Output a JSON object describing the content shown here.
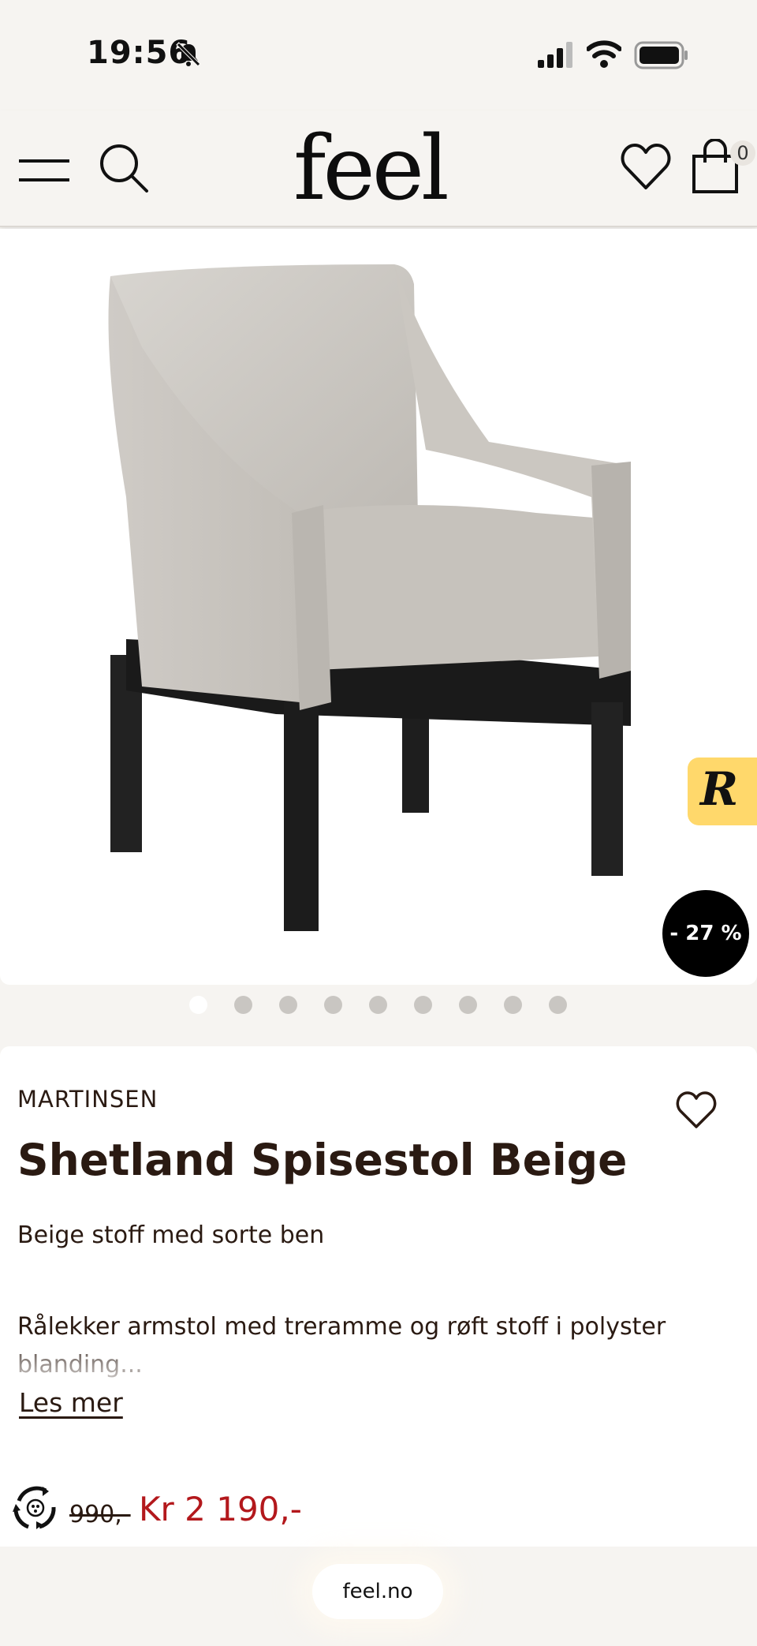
{
  "status_bar": {
    "time": "19:56"
  },
  "header": {
    "logo": "feel",
    "cart_count": "0"
  },
  "product": {
    "image_alt": "Shetland Spisestol Beige",
    "discount": "- 27 %",
    "gallery_count": 9,
    "gallery_active_index": 0,
    "brand": "MARTINSEN",
    "title": "Shetland Spisestol Beige",
    "subtitle": "Beige stoff med sorte ben",
    "description": "Rålekker armstol med treramme og røft stoff i polyster blanding...",
    "read_more": "Les mer",
    "old_price": "990,-",
    "new_price": "Kr 2 190,-"
  },
  "browser": {
    "url": "feel.no"
  },
  "colors": {
    "accent_price": "#b3181c",
    "r_badge": "#ffd86b",
    "text": "#2a1a12"
  }
}
